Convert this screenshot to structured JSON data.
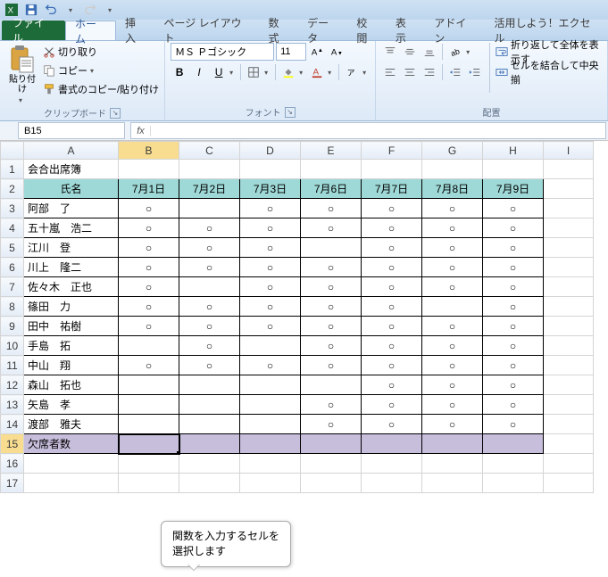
{
  "qat": {
    "excel": "X"
  },
  "tabs": {
    "file": "ファイル",
    "home": "ホーム",
    "insert": "挿入",
    "pagelayout": "ページ レイアウト",
    "formulas": "数式",
    "data": "データ",
    "review": "校閲",
    "view": "表示",
    "addins": "アドイン",
    "katsuyou": "活用しよう！エクセル"
  },
  "ribbon": {
    "clipboard": {
      "paste": "貼り付け",
      "cut": "切り取り",
      "copy": "コピー",
      "format_painter": "書式のコピー/貼り付け",
      "label": "クリップボード"
    },
    "font": {
      "name": "ＭＳ Ｐゴシック",
      "size": "11",
      "label": "フォント"
    },
    "alignment": {
      "wrap": "折り返して全体を表示す",
      "merge": "セルを結合して中央揃",
      "label": "配置"
    }
  },
  "namebox": "B15",
  "fx": "fx",
  "columns": [
    "A",
    "B",
    "C",
    "D",
    "E",
    "F",
    "G",
    "H",
    "I"
  ],
  "sheet": {
    "title": "会合出席簿",
    "name_hdr": "氏名",
    "dates": [
      "7月1日",
      "7月2日",
      "7月3日",
      "7月6日",
      "7月7日",
      "7月8日",
      "7月9日"
    ],
    "rows": [
      {
        "name": "阿部　了",
        "marks": [
          "○",
          "",
          "○",
          "○",
          "○",
          "○",
          "○"
        ]
      },
      {
        "name": "五十嵐　浩二",
        "marks": [
          "○",
          "○",
          "○",
          "○",
          "○",
          "○",
          "○"
        ]
      },
      {
        "name": "江川　登",
        "marks": [
          "○",
          "○",
          "○",
          "",
          "○",
          "○",
          "○"
        ]
      },
      {
        "name": "川上　隆二",
        "marks": [
          "○",
          "○",
          "○",
          "○",
          "○",
          "○",
          "○"
        ]
      },
      {
        "name": "佐々木　正也",
        "marks": [
          "○",
          "",
          "○",
          "○",
          "○",
          "○",
          "○"
        ]
      },
      {
        "name": "篠田　力",
        "marks": [
          "○",
          "○",
          "○",
          "○",
          "○",
          "",
          "○"
        ]
      },
      {
        "name": "田中　祐樹",
        "marks": [
          "○",
          "○",
          "○",
          "○",
          "○",
          "○",
          "○"
        ]
      },
      {
        "name": "手島　拓",
        "marks": [
          "",
          "○",
          "",
          "○",
          "○",
          "○",
          "○"
        ]
      },
      {
        "name": "中山　翔",
        "marks": [
          "○",
          "○",
          "○",
          "○",
          "○",
          "○",
          "○"
        ]
      },
      {
        "name": "森山　拓也",
        "marks": [
          "",
          "",
          "",
          "",
          "○",
          "○",
          "○"
        ]
      },
      {
        "name": "矢島　孝",
        "marks": [
          "",
          "",
          "",
          "○",
          "○",
          "○",
          "○"
        ]
      },
      {
        "name": "渡部　雅夫",
        "marks": [
          "",
          "",
          "",
          "○",
          "○",
          "○",
          "○"
        ]
      }
    ],
    "absent_label": "欠席者数"
  },
  "tooltip": {
    "line1": "関数を入力するセルを",
    "line2": "選択します"
  }
}
